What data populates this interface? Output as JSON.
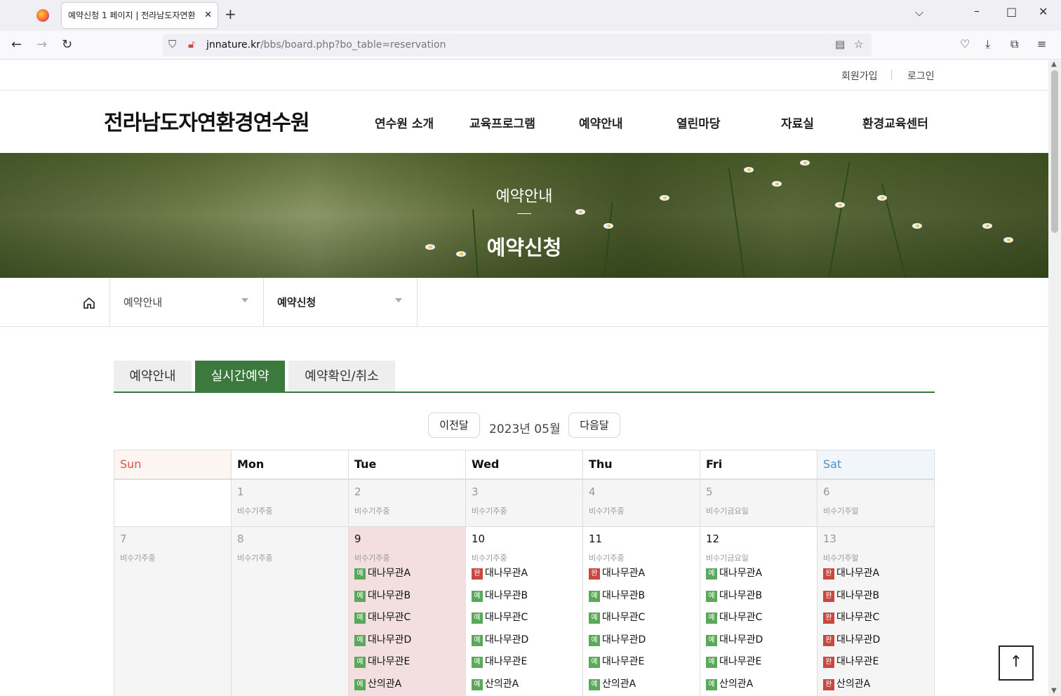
{
  "browser": {
    "tab_title": "예약신청 1 페이지 | 전라남도자연환",
    "tab_close": "✕",
    "new_tab": "+",
    "url_domain": "jnnature.kr",
    "url_path": "/bbs/board.php?bo_table=reservation"
  },
  "header": {
    "util_join": "회원가입",
    "util_login": "로그인",
    "logo": "전라남도자연환경연수원",
    "gnb": [
      "연수원 소개",
      "교육프로그램",
      "예약안내",
      "열린마당",
      "자료실",
      "환경교육센터"
    ]
  },
  "hero": {
    "subtitle": "예약안내",
    "title": "예약신청"
  },
  "location": {
    "depth1": "예약안내",
    "depth2": "예약신청"
  },
  "page_tabs": [
    "예약안내",
    "실시간예약",
    "예약확인/취소"
  ],
  "page_tabs_active": 1,
  "month_nav": {
    "prev": "이전달",
    "label": "2023년 05월",
    "next": "다음달"
  },
  "calendar": {
    "weekdays": [
      "Sun",
      "Mon",
      "Tue",
      "Wed",
      "Thu",
      "Fri",
      "Sat"
    ],
    "week1": [
      {
        "day": "",
        "type": ""
      },
      {
        "day": "1",
        "type": "비수기주중"
      },
      {
        "day": "2",
        "type": "비수기주중"
      },
      {
        "day": "3",
        "type": "비수기주중"
      },
      {
        "day": "4",
        "type": "비수기주중"
      },
      {
        "day": "5",
        "type": "비수기금요일"
      },
      {
        "day": "6",
        "type": "비수기주말"
      }
    ],
    "week2": [
      {
        "day": "7",
        "type": "비수기주중"
      },
      {
        "day": "8",
        "type": "비수기주중"
      },
      {
        "day": "9",
        "type": "비수기주중"
      },
      {
        "day": "10",
        "type": "비수기주중"
      },
      {
        "day": "11",
        "type": "비수기주중"
      },
      {
        "day": "12",
        "type": "비수기금요일"
      },
      {
        "day": "13",
        "type": "비수기주말"
      }
    ],
    "rooms": [
      "대나무관A",
      "대나무관B",
      "대나무관C",
      "대나무관D",
      "대나무관E",
      "산의관A"
    ],
    "badge_available": "예",
    "badge_full": "완",
    "badge_available_color": "#5aa85a",
    "badge_full_color": "#c9473f",
    "status": {
      "tue": [
        "예",
        "예",
        "예",
        "예",
        "예",
        "예"
      ],
      "wed": [
        "완",
        "예",
        "예",
        "예",
        "예",
        "예"
      ],
      "thu": [
        "완",
        "예",
        "예",
        "예",
        "예",
        "예"
      ],
      "fri": [
        "예",
        "예",
        "예",
        "예",
        "예",
        "예"
      ],
      "sat": [
        "완",
        "완",
        "완",
        "완",
        "완",
        "완"
      ]
    }
  },
  "top_button": "↑",
  "colors": {
    "accent": "#3b7a3c",
    "sunday": "#d9534f",
    "saturday": "#4a90c8",
    "today_bg": "#f3dfe0"
  }
}
